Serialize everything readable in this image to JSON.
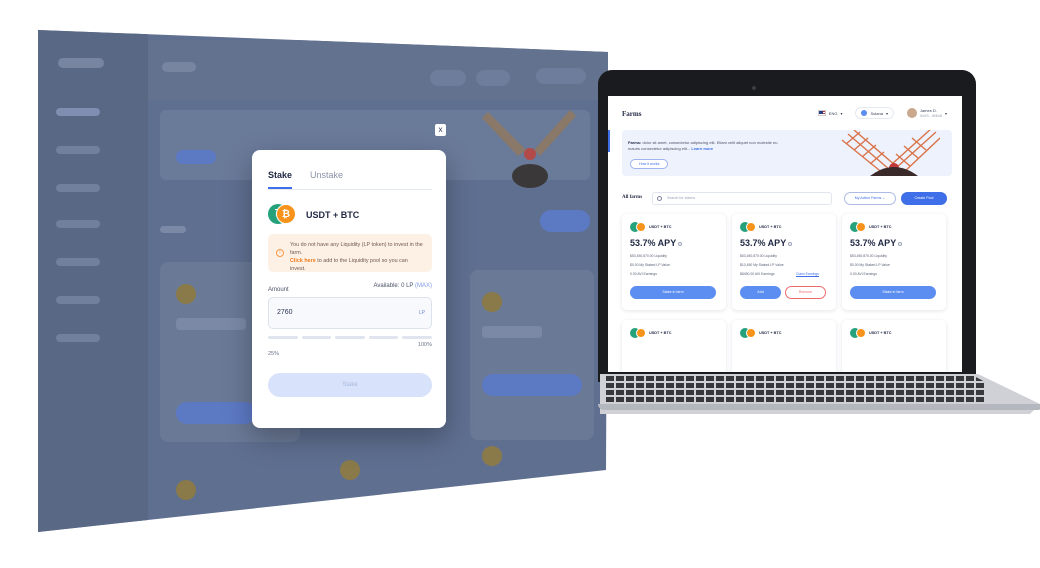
{
  "modal": {
    "close_label": "x",
    "tabs": [
      {
        "label": "Stake",
        "active": true
      },
      {
        "label": "Unstake",
        "active": false
      }
    ],
    "pair_icon_a": "₮",
    "pair_icon_b": "₿",
    "pair_name": "USDT + BTC",
    "warning_text": "You do not have any Liquidity (LP token) to invest in the farm.",
    "warning_link": "Click here",
    "warning_suffix": " to add to the Liquidity pool so you can invest.",
    "amount_label": "Amount",
    "available_prefix": "Available: ",
    "available_value": "0 LP",
    "available_suffix": " (MAX)",
    "amount_value": "2760",
    "amount_unit": "LP",
    "pct_min": "25%",
    "pct_max": "100%",
    "stake_button": "Stake"
  },
  "laptop": {
    "page_title": "Farms",
    "language": "ENG",
    "network": "Solana",
    "user_name": "James D.",
    "user_addr": "0x93...9f4b6",
    "banner_bold": "Farms:",
    "banner_text": " dolor sit amet, consectetur adipiscing elit. Etiam velit aliquet non molestie eu mauris consectetur adipiscing elit... ",
    "banner_link": "Learn more",
    "how_button": "How it works",
    "all_farms": "All farms",
    "search_placeholder": "Search for tokens",
    "filter_label": "My Active Farms",
    "create_label": "Create Pool",
    "cards": [
      {
        "pair": "USDT + BTC",
        "apy": "53.7% APY",
        "liquidity": "$53,450,870.00 Liquidity",
        "staked": "$0.00 My Staked LP Value",
        "earnings": "0.00 AVI Earnings",
        "claim": "",
        "btn": "Stake in farm"
      },
      {
        "pair": "USDT + BTC",
        "apy": "53.7% APY",
        "liquidity": "$53,450,870.00 Liquidity",
        "staked": "$10,450 My Staked LP Value",
        "earnings": "$8450.00 AVI Earnings",
        "claim": "Claim Earnings",
        "btn_add": "Add",
        "btn_remove": "Remove"
      },
      {
        "pair": "USDT + BTC",
        "apy": "53.7% APY",
        "liquidity": "$53,450,870.00 Liquidity",
        "staked": "$0.00 My Staked LP Value",
        "earnings": "0.00 AVI Earnings",
        "claim": "",
        "btn": "Stake in farm"
      },
      {
        "pair": "USDT + BTC"
      },
      {
        "pair": "USDT + BTC"
      },
      {
        "pair": "USDT + BTC"
      }
    ]
  },
  "colors": {
    "accent": "#3e6ee8",
    "usdt": "#26a17b",
    "btc": "#f7931a",
    "warning_bg": "#fdf1e6",
    "remove": "#ef6b6b",
    "overlay": "#5f6f90"
  },
  "icons": [
    "close-icon",
    "usdt-icon",
    "btc-icon",
    "warning-icon",
    "search-icon",
    "info-icon",
    "flag-icon",
    "solana-icon",
    "avatar",
    "chevron-down-icon",
    "windmill-illustration"
  ]
}
